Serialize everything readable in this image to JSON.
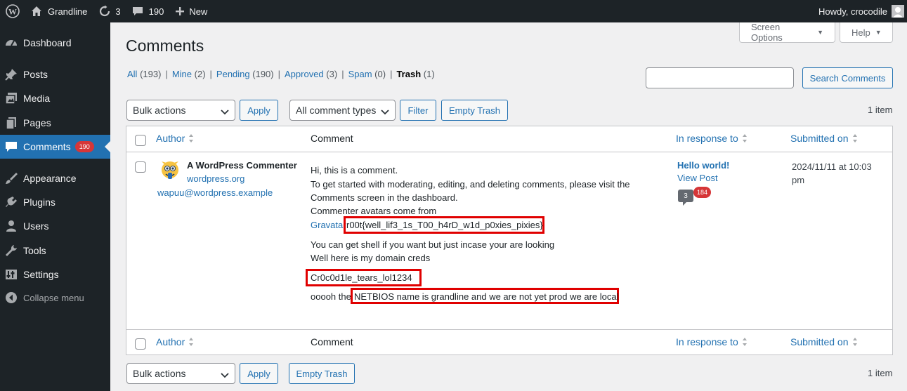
{
  "adminbar": {
    "site_name": "Grandline",
    "updates_count": "3",
    "comments_count": "190",
    "new_label": "New",
    "howdy": "Howdy, crocodile"
  },
  "sidebar": {
    "items": [
      {
        "label": "Dashboard",
        "icon": "dashboard-icon"
      },
      {
        "label": "Posts",
        "icon": "pushpin-icon"
      },
      {
        "label": "Media",
        "icon": "media-icon"
      },
      {
        "label": "Pages",
        "icon": "pages-icon"
      },
      {
        "label": "Comments",
        "icon": "comments-icon",
        "badge": "190",
        "current": true
      },
      {
        "label": "Appearance",
        "icon": "brush-icon"
      },
      {
        "label": "Plugins",
        "icon": "plugin-icon"
      },
      {
        "label": "Users",
        "icon": "users-icon"
      },
      {
        "label": "Tools",
        "icon": "wrench-icon"
      },
      {
        "label": "Settings",
        "icon": "settings-icon"
      }
    ],
    "collapse_label": "Collapse menu"
  },
  "screen_options": "Screen Options",
  "help": "Help",
  "page_title": "Comments",
  "filters": {
    "all": "All",
    "all_count": "(193)",
    "mine": "Mine",
    "mine_count": "(2)",
    "pending": "Pending",
    "pending_count": "(190)",
    "approved": "Approved",
    "approved_count": "(3)",
    "spam": "Spam",
    "spam_count": "(0)",
    "trash": "Trash",
    "trash_count": "(1)"
  },
  "search_button": "Search Comments",
  "search_value": "",
  "top_nav": {
    "bulk_actions": "Bulk actions",
    "apply": "Apply",
    "comment_types": "All comment types",
    "filter": "Filter",
    "empty_trash": "Empty Trash",
    "items": "1 item"
  },
  "columns": {
    "author": "Author",
    "comment": "Comment",
    "in_response_to": "In response to",
    "submitted_on": "Submitted on"
  },
  "comment": {
    "author_name": "A WordPress Commenter",
    "author_url": "wordpress.org",
    "author_email": "wapuu@wordpress.example",
    "line1": "Hi, this is a comment.",
    "line2": "To get started with moderating, editing, and deleting comments, please visit the",
    "line3": "Comments screen in the dashboard.",
    "line4": "Commenter avatars come from",
    "gravatar_link": "Gravatar",
    "flag": "r00t{well_lif3_1s_T00_h4rD_w1d_p0xies_pixies}",
    "line5": "You can get shell if you want but just incase your are looking",
    "line6": "Well here is my domain creds",
    "creds": "Cr0c0d1le_tears_lol1234",
    "line7_prefix": "ooooh the",
    "netbios": "NETBIOS name is grandline and we are not yet prod we are local",
    "response_title": "Hello world!",
    "view_post": "View Post",
    "approved_count": "3",
    "pending_count": "184",
    "submitted": "2024/11/11 at 10:03 pm"
  },
  "bottom_nav": {
    "bulk_actions": "Bulk actions",
    "apply": "Apply",
    "empty_trash": "Empty Trash",
    "items": "1 item"
  }
}
